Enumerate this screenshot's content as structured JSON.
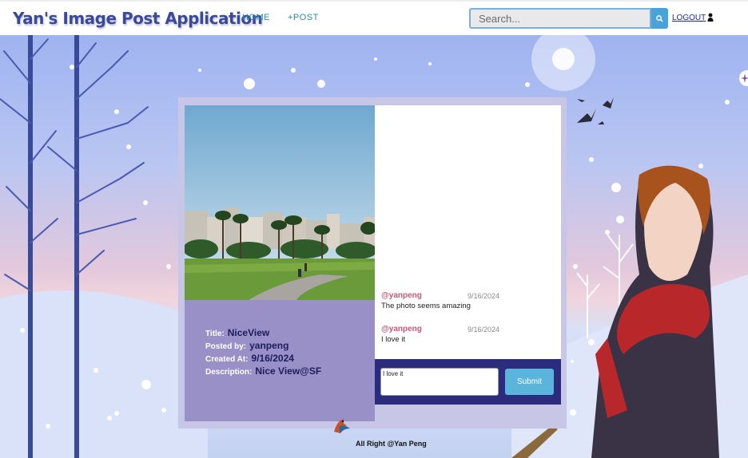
{
  "header": {
    "brand": "Yan's Image Post Application",
    "nav_home": "HOME",
    "nav_post": "+POST",
    "search_placeholder": "Search...",
    "logout": "LOGOUT"
  },
  "post": {
    "title_label": "Title:",
    "title": "NiceView",
    "posted_by_label": "Posted by:",
    "posted_by": "yanpeng",
    "created_label": "Created At:",
    "created_at": "9/16/2024",
    "description_label": "Description:",
    "description": "Nice View@SF"
  },
  "comments": [
    {
      "user": "@yanpeng",
      "date": "9/16/2024",
      "text": "The photo seems amazing"
    },
    {
      "user": "@yanpeng",
      "date": "9/16/2024",
      "text": "I love it"
    }
  ],
  "compose": {
    "value": "I love it",
    "submit": "Submit"
  },
  "footer": {
    "text": "All Right @Yan Peng"
  },
  "colors": {
    "brand": "#3a4a9a",
    "accent": "#4aa3d8",
    "info_panel": "#9a90c8",
    "compose_bg": "#2b2c7e",
    "comment_user": "#c8587a"
  }
}
